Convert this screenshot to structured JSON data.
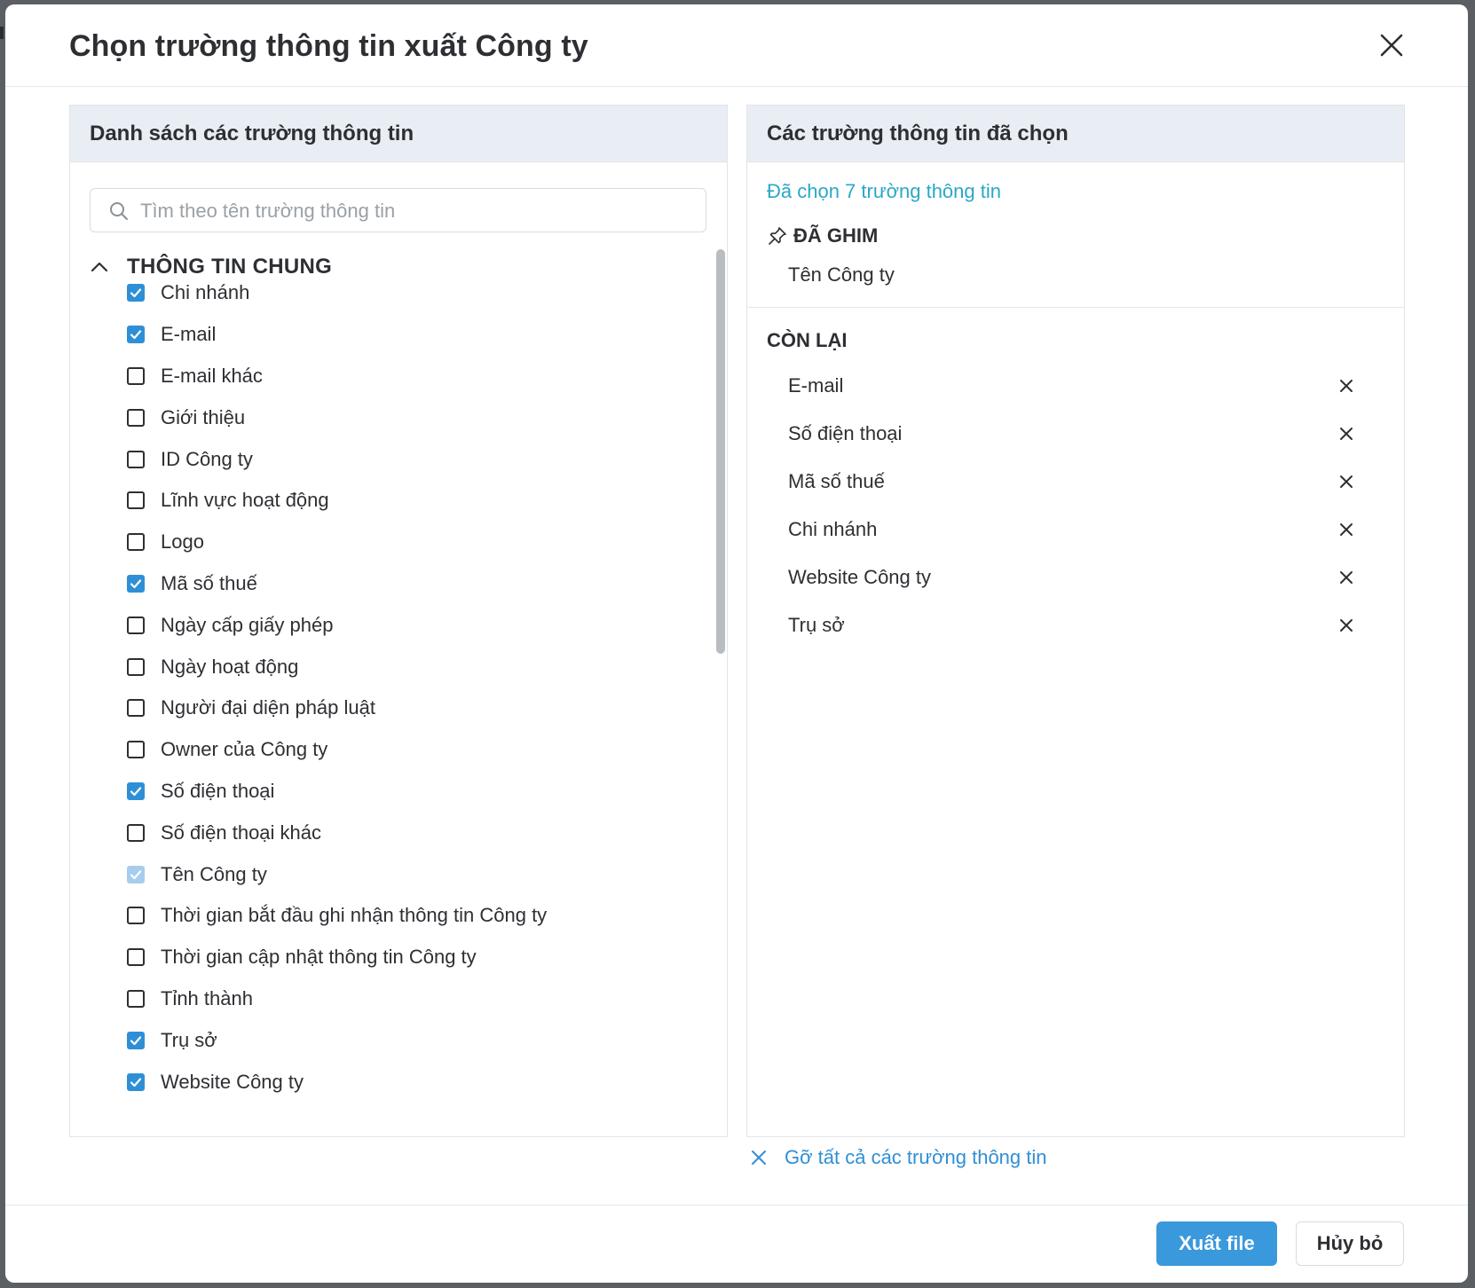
{
  "dialog": {
    "title": "Chọn trường thông tin xuất Công ty"
  },
  "left_panel": {
    "header": "Danh sách các trường thông tin",
    "search_placeholder": "Tìm theo tên trường thông tin",
    "group_title": "THÔNG TIN CHUNG",
    "fields": [
      {
        "label": "Chi nhánh",
        "state": "checked"
      },
      {
        "label": "E-mail",
        "state": "checked"
      },
      {
        "label": "E-mail khác",
        "state": "unchecked"
      },
      {
        "label": "Giới thiệu",
        "state": "unchecked"
      },
      {
        "label": "ID Công ty",
        "state": "unchecked"
      },
      {
        "label": "Lĩnh vực hoạt động",
        "state": "unchecked"
      },
      {
        "label": "Logo",
        "state": "unchecked"
      },
      {
        "label": "Mã số thuế",
        "state": "checked"
      },
      {
        "label": "Ngày cấp giấy phép",
        "state": "unchecked"
      },
      {
        "label": "Ngày hoạt động",
        "state": "unchecked"
      },
      {
        "label": "Người đại diện pháp luật",
        "state": "unchecked"
      },
      {
        "label": "Owner của Công ty",
        "state": "unchecked"
      },
      {
        "label": "Số điện thoại",
        "state": "checked"
      },
      {
        "label": "Số điện thoại khác",
        "state": "unchecked"
      },
      {
        "label": "Tên Công ty",
        "state": "checked-disabled"
      },
      {
        "label": "Thời gian bắt đầu ghi nhận thông tin Công ty",
        "state": "unchecked"
      },
      {
        "label": "Thời gian cập nhật thông tin Công ty",
        "state": "unchecked"
      },
      {
        "label": "Tỉnh thành",
        "state": "unchecked"
      },
      {
        "label": "Trụ sở",
        "state": "checked"
      },
      {
        "label": "Website Công ty",
        "state": "checked"
      }
    ]
  },
  "right_panel": {
    "header": "Các trường thông tin đã chọn",
    "selected_count_text": "Đã chọn 7 trường thông tin",
    "pinned_title": "ĐÃ GHIM",
    "pinned_items": [
      "Tên Công ty"
    ],
    "remaining_title": "CÒN LẠI",
    "remaining_items": [
      "E-mail",
      "Số điện thoại",
      "Mã số thuế",
      "Chi nhánh",
      "Website Công ty",
      "Trụ sở"
    ]
  },
  "actions": {
    "clear_all": "Gỡ tất cả các trường thông tin",
    "export": "Xuất file",
    "cancel": "Hủy bỏ"
  },
  "colors": {
    "accent": "#3a98dc",
    "link": "#2aa7c9",
    "panel_header_bg": "#e9eef4",
    "checkbox_checked": "#2f8fd6",
    "checkbox_disabled": "#a6cdee"
  },
  "icons": {
    "close": "close-icon",
    "search": "search-icon",
    "collapse": "chevron-up-icon",
    "pin": "pin-icon",
    "remove": "x-icon"
  }
}
